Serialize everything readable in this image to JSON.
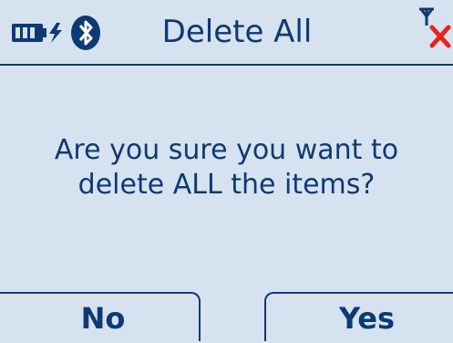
{
  "status_bar": {
    "title": "Delete All",
    "battery_icon": "battery-charging-icon",
    "bluetooth_icon": "bluetooth-icon",
    "signal_icon": "no-signal-icon"
  },
  "dialog": {
    "line1": "Are you sure you want to",
    "line2": "delete ALL the items?"
  },
  "softkeys": {
    "left_label": "No",
    "right_label": "Yes"
  },
  "colors": {
    "background": "#d6e2ef",
    "text": "#0d3a73",
    "alert": "#e8231c"
  }
}
